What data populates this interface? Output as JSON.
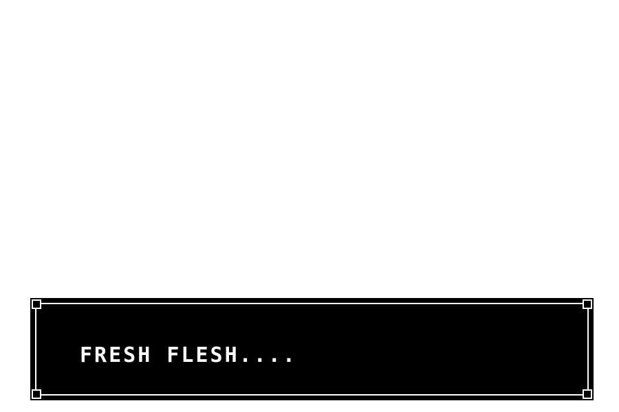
{
  "dialog": {
    "text": "FRESH FLESH...."
  },
  "colors": {
    "background": "#ffffff",
    "box": "#000000",
    "text": "#ffffff",
    "border": "#ffffff"
  }
}
